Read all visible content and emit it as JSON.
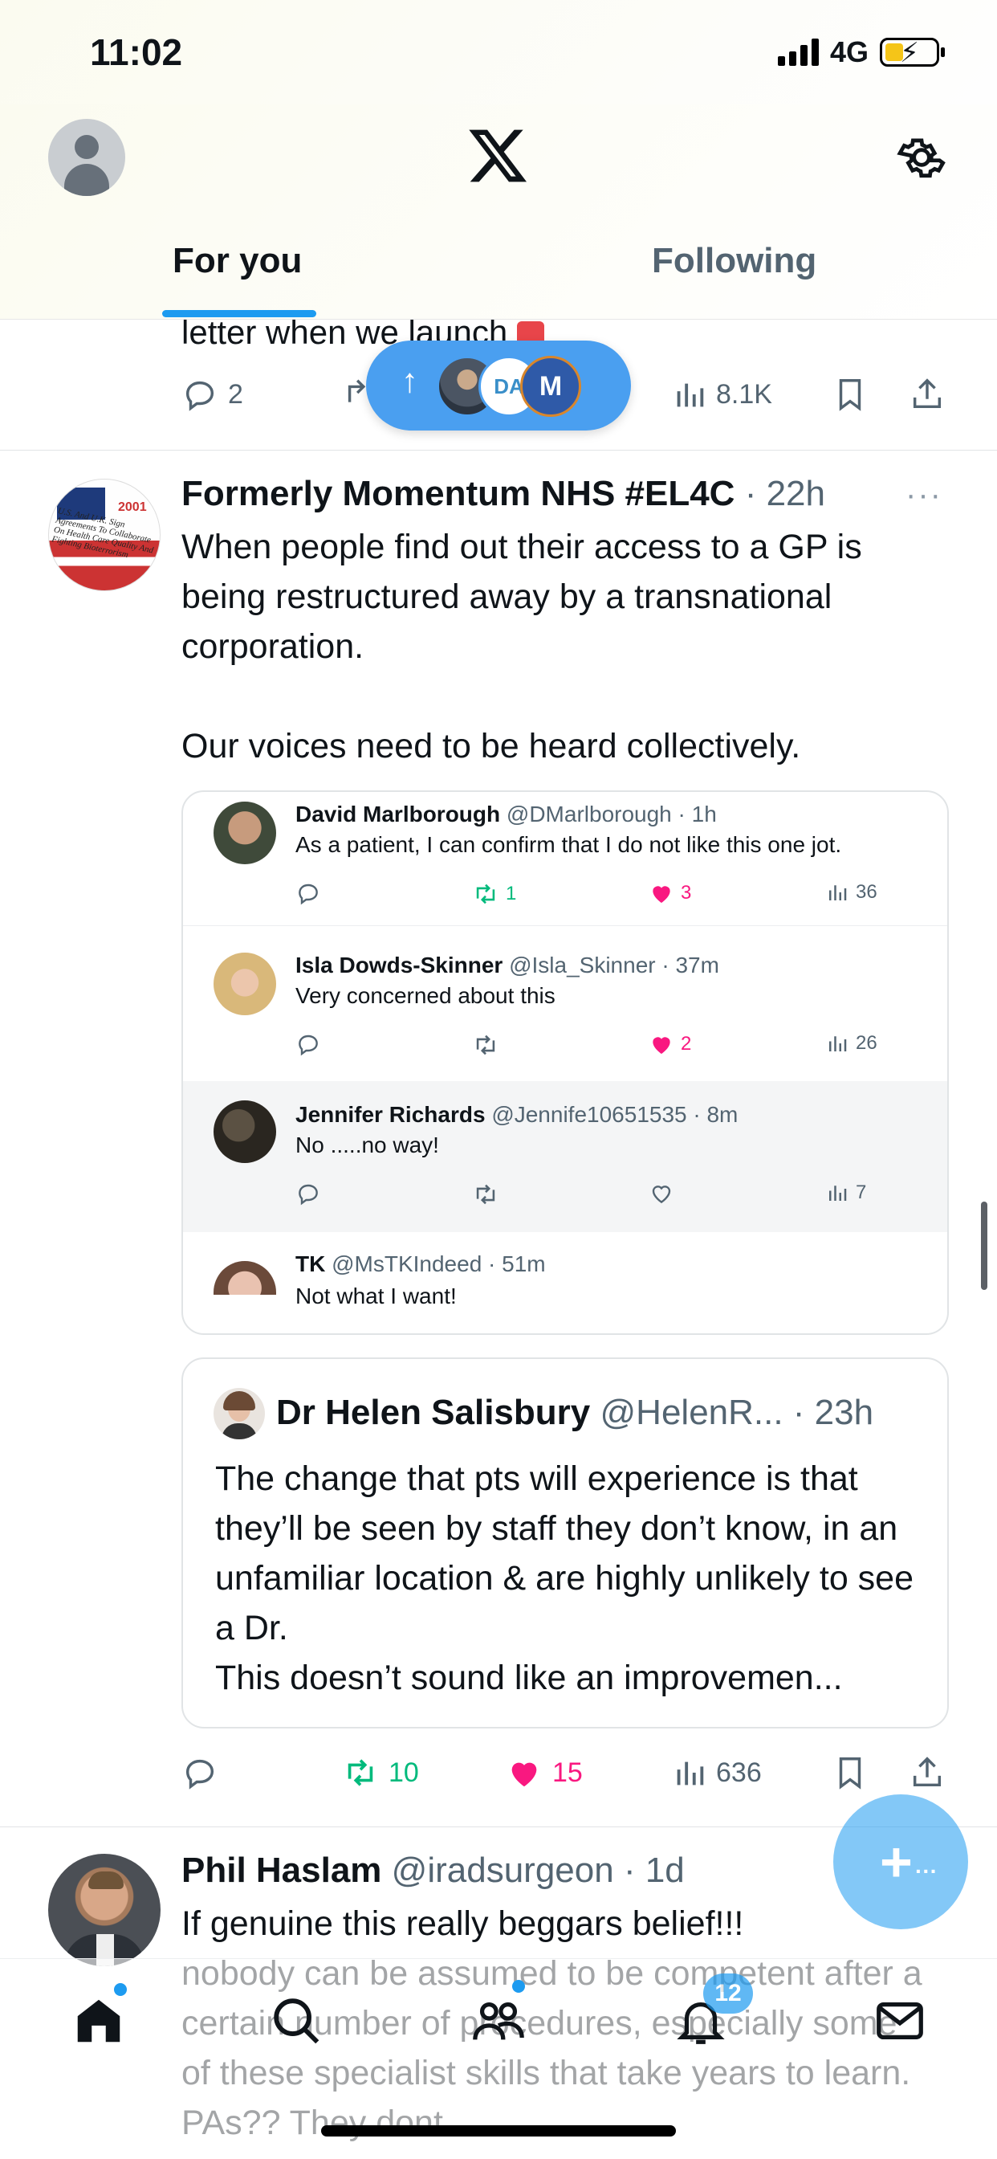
{
  "status": {
    "time": "11:02",
    "network": "4G"
  },
  "header": {
    "tabs": [
      {
        "label": "For you"
      },
      {
        "label": "Following"
      }
    ]
  },
  "prev_tweet": {
    "text_tail": "letter when we launch",
    "replies": "2",
    "views": "8.1K"
  },
  "new_posts_pill": {
    "avatar_labels": [
      "DA",
      "M"
    ]
  },
  "tweet1": {
    "name": "Formerly Momentum NHS #EL4C",
    "meta": "· 22h",
    "text": "When people find out their access to a GP is being restructured away by a transnational corporation.\n\nOur voices need to be heard collectively.",
    "avatar_text": "U.S. And U.K. Sign Agreements To Collaborate On Health Care Quality And Fighting Bioterrorism",
    "avatar_year": "2001",
    "embed": [
      {
        "name": "David Marlborough",
        "handle": "@DMarlborough · 1h",
        "text": "As a patient, I can confirm that I do not like this one jot.",
        "retweets": "1",
        "likes": "3",
        "views": "36"
      },
      {
        "name": "Isla Dowds-Skinner",
        "handle": "@Isla_Skinner · 37m",
        "text": "Very concerned about this",
        "retweets": "",
        "likes": "2",
        "views": "26"
      },
      {
        "name": "Jennifer Richards",
        "handle": "@Jennife10651535 · 8m",
        "text": "No .....no way!",
        "retweets": "",
        "likes": "",
        "views": "7"
      },
      {
        "name": "TK",
        "handle": "@MsTKIndeed · 51m",
        "text": "Not what I want!"
      }
    ],
    "quote": {
      "name": "Dr Helen Salisbury",
      "meta": "@HelenR... · 23h",
      "text": "The change that pts will experience is that they’ll be seen by staff they don’t know, in an unfamiliar location & are highly unlikely to see a Dr.\nThis doesn’t sound like an improvemen..."
    },
    "retweets": "10",
    "likes": "15",
    "views": "636"
  },
  "tweet2": {
    "name": "Phil Haslam",
    "meta": "@iradsurgeon · 1d",
    "text": "If genuine this really beggars belief!!!\nnobody can be assumed to be competent after a certain number of procedures, especially some of these specialist skills that take years to learn. PAs?? They dont"
  },
  "nav": {
    "notifications_badge": "12"
  },
  "colors": {
    "accent": "#1d9bf0",
    "retweet": "#00ba7c",
    "like": "#f91880"
  }
}
